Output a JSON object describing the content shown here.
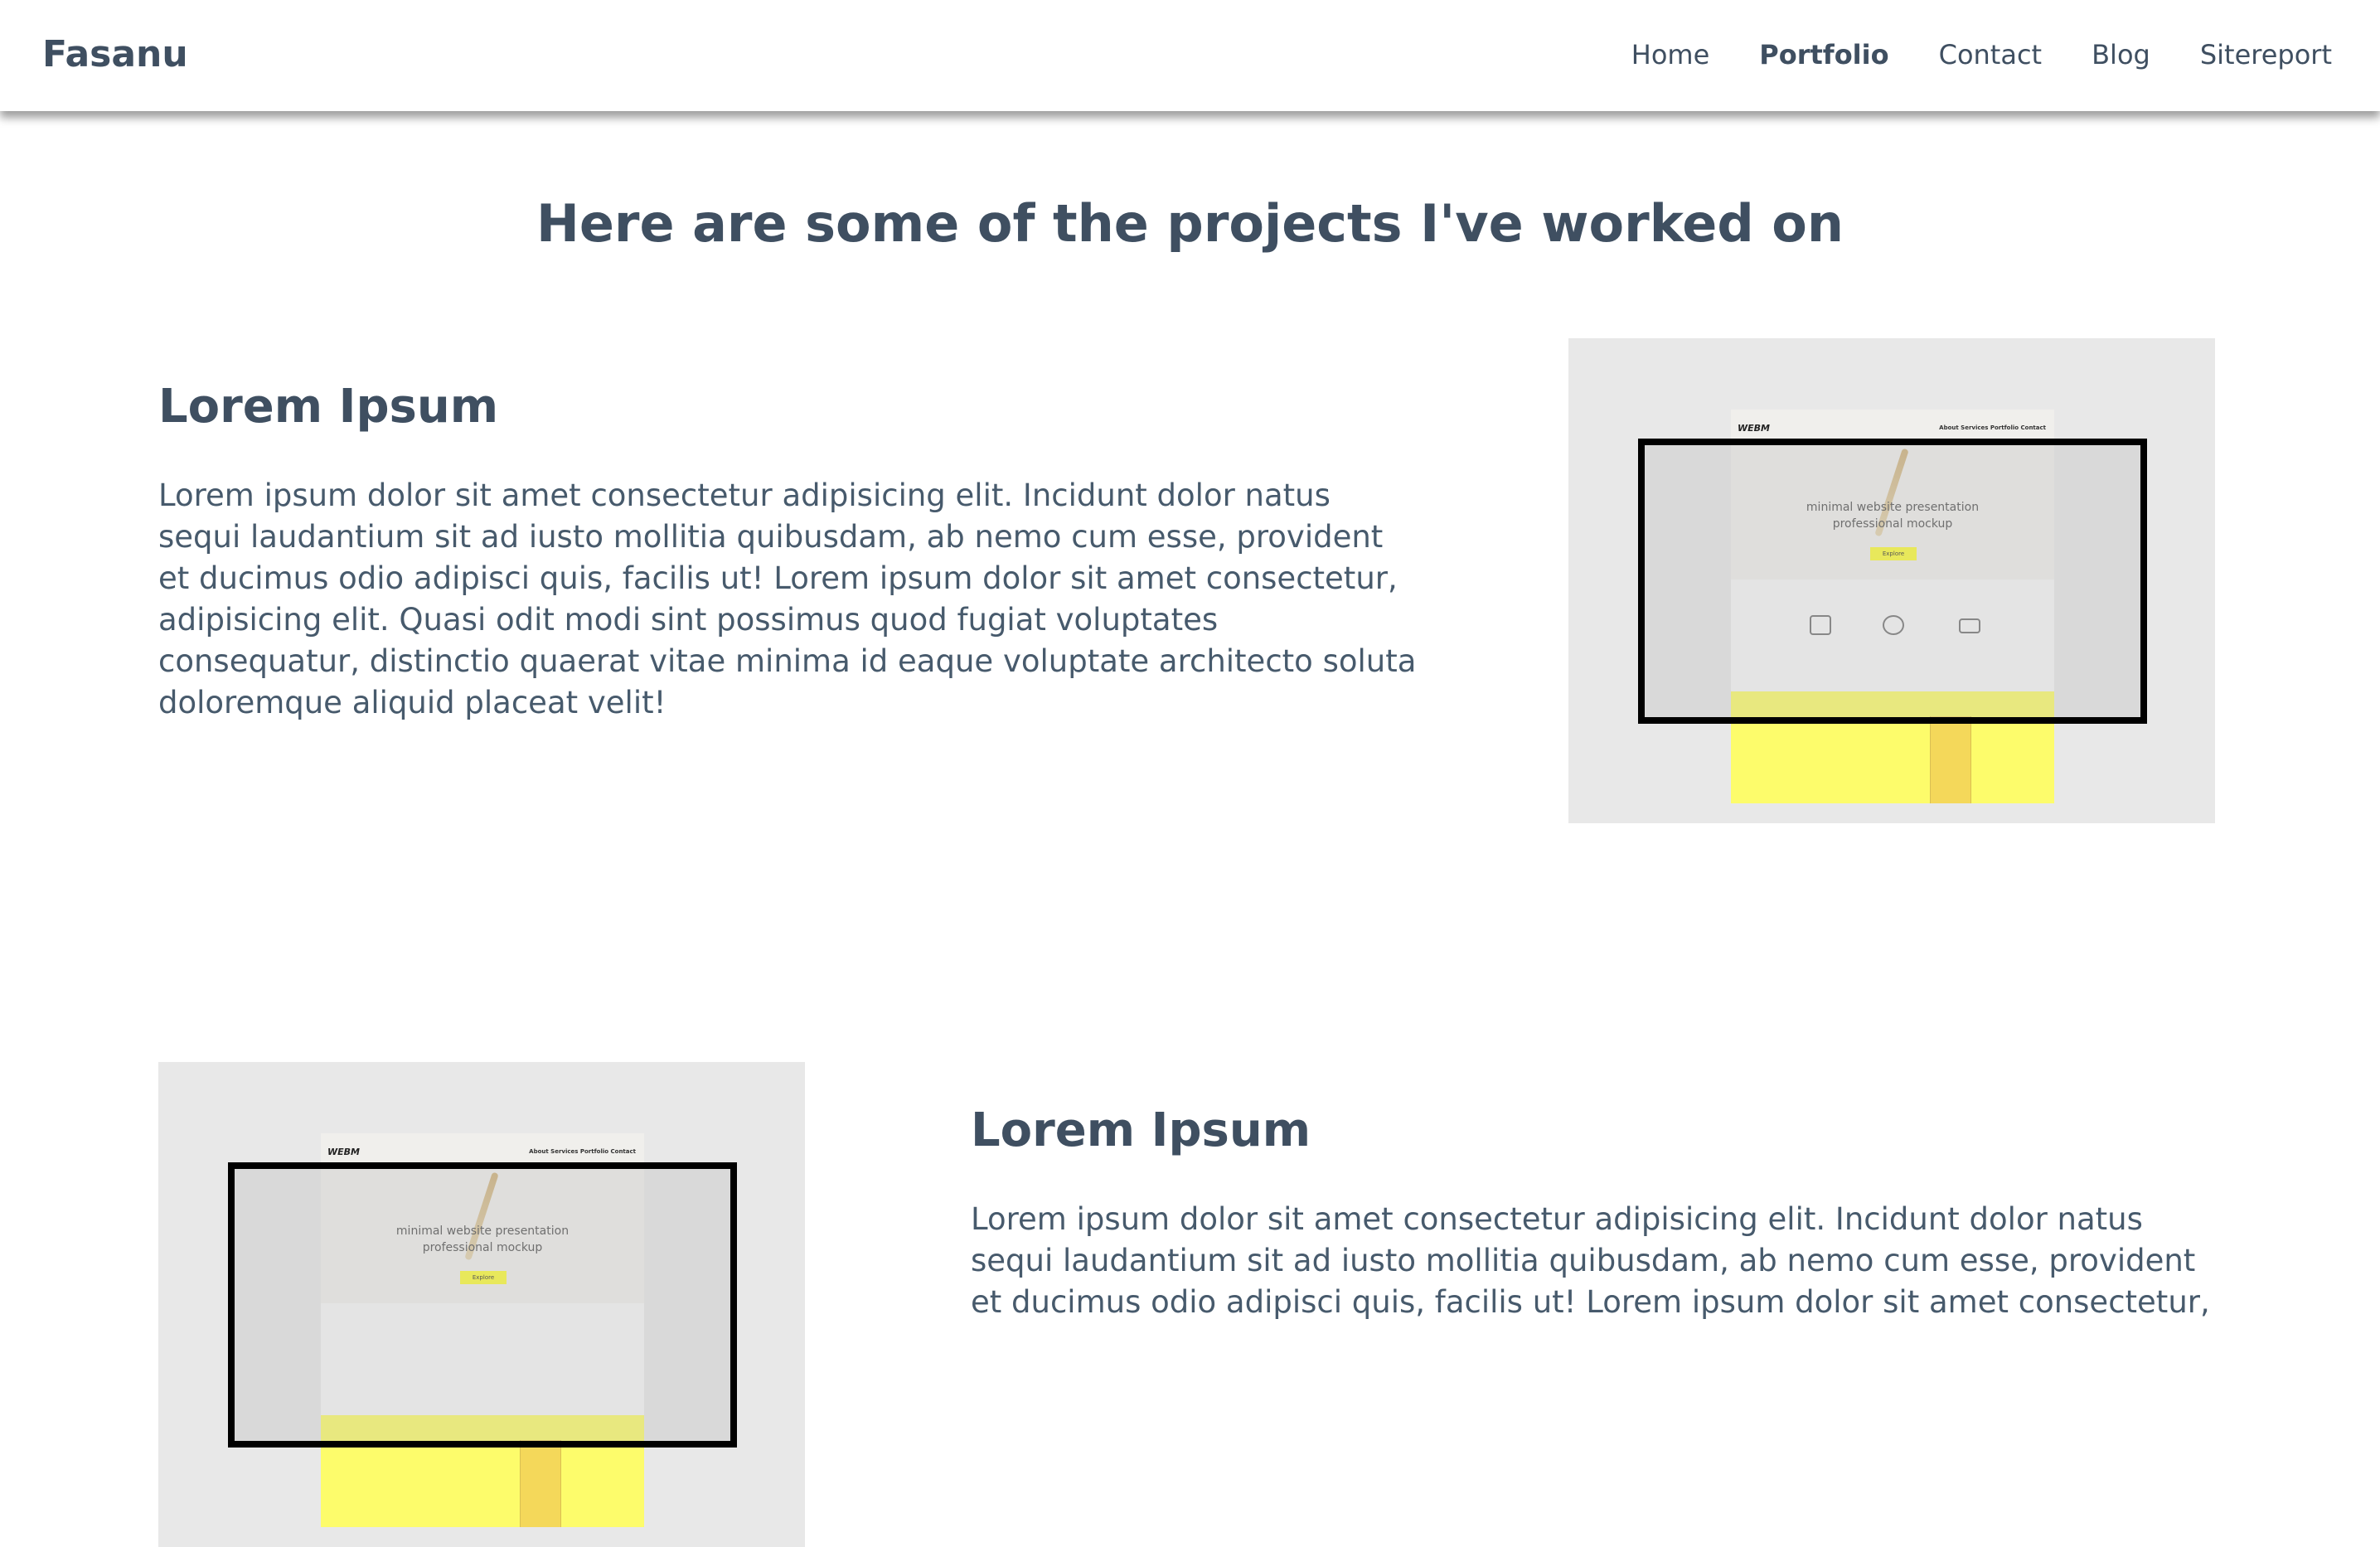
{
  "header": {
    "brand": "Fasanu",
    "nav": [
      {
        "label": "Home",
        "active": false
      },
      {
        "label": "Portfolio",
        "active": true
      },
      {
        "label": "Contact",
        "active": false
      },
      {
        "label": "Blog",
        "active": false
      },
      {
        "label": "Sitereport",
        "active": false
      }
    ]
  },
  "main": {
    "title": "Here are some of the projects I've worked on",
    "projects": [
      {
        "title": "Lorem Ipsum",
        "description": "Lorem ipsum dolor sit amet consectetur adipisicing elit. Incidunt dolor natus sequi laudantium sit ad iusto mollitia quibusdam, ab nemo cum esse, provident et ducimus odio adipisci quis, facilis ut! Lorem ipsum dolor sit amet consectetur, adipisicing elit. Quasi odit modi sint possimus quod fugiat voluptates consequatur, distinctio quaerat vitae minima id eaque voluptate architecto soluta doloremque aliquid placeat velit!",
        "image": {
          "logo": "WEBM",
          "menu": "About  Services  Portfolio  Contact",
          "tagline_1": "minimal website presentation",
          "tagline_2": "professional mockup",
          "button": "Explore"
        }
      },
      {
        "title": "Lorem Ipsum",
        "description": "Lorem ipsum dolor sit amet consectetur adipisicing elit. Incidunt dolor natus sequi laudantium sit ad iusto mollitia quibusdam, ab nemo cum esse, provident et ducimus odio adipisci quis, facilis ut! Lorem ipsum dolor sit amet consectetur,",
        "image": {
          "logo": "WEBM",
          "menu": "About  Services  Portfolio  Contact",
          "tagline_1": "minimal website presentation",
          "tagline_2": "professional mockup",
          "button": "Explore"
        }
      }
    ]
  },
  "colors": {
    "text": "#3f4f61",
    "mock_bg": "#e8e8e8",
    "mock_yellow": "#fdfc6b"
  }
}
